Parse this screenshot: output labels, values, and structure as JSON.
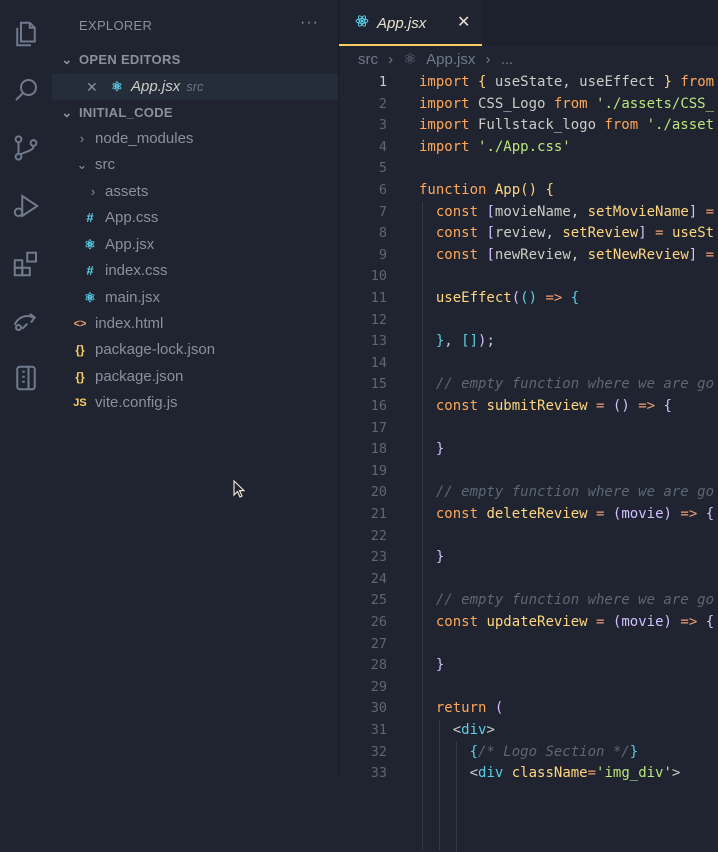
{
  "activity_bar": [
    {
      "icon": "files-icon"
    },
    {
      "icon": "search-icon"
    },
    {
      "icon": "source-control-icon"
    },
    {
      "icon": "run-debug-icon"
    },
    {
      "icon": "extensions-icon"
    },
    {
      "icon": "remote-explorer-icon"
    },
    {
      "icon": "testing-icon"
    }
  ],
  "sidebar": {
    "title": "EXPLORER",
    "more": "···",
    "open_editors": {
      "label": "OPEN EDITORS",
      "items": [
        {
          "name": "App.jsx",
          "desc": "src"
        }
      ]
    },
    "project": {
      "label": "INITIAL_CODE",
      "tree": [
        {
          "name": "node_modules",
          "icon": "›",
          "type": "folder"
        },
        {
          "name": "src",
          "icon": "⌄",
          "type": "folder"
        },
        {
          "name": "assets",
          "icon": "›",
          "type": "folder"
        },
        {
          "name": "App.css",
          "icon": "#",
          "type": "css"
        },
        {
          "name": "App.jsx",
          "icon": "⚛",
          "type": "react"
        },
        {
          "name": "index.css",
          "icon": "#",
          "type": "css"
        },
        {
          "name": "main.jsx",
          "icon": "⚛",
          "type": "react"
        },
        {
          "name": "index.html",
          "icon": "<>",
          "type": "html"
        },
        {
          "name": "package-lock.json",
          "icon": "{}",
          "type": "json"
        },
        {
          "name": "package.json",
          "icon": "{}",
          "type": "json"
        },
        {
          "name": "vite.config.js",
          "icon": "JS",
          "type": "js"
        }
      ]
    }
  },
  "editor": {
    "tab": {
      "label": "App.jsx",
      "close": "✕"
    },
    "breadcrumb": [
      "src",
      "›",
      "App.jsx",
      "›",
      "..."
    ],
    "current_line": 1,
    "lines": [
      "1",
      "2",
      "3",
      "4",
      "5",
      "6",
      "7",
      "8",
      "9",
      "10",
      "11",
      "12",
      "13",
      "14",
      "15",
      "16",
      "17",
      "18",
      "19",
      "20",
      "21",
      "22",
      "23",
      "24",
      "25",
      "26",
      "27",
      "28",
      "29",
      "30",
      "31",
      "32",
      "33"
    ]
  },
  "colors": {
    "bg": "#1f2430",
    "accent": "#ffcc66",
    "css_icon": "#5ccfe6",
    "react_icon": "#5ccfe6",
    "html_icon": "#f29e74",
    "json_icon": "#ffcc66",
    "js_icon": "#ffcc66"
  }
}
